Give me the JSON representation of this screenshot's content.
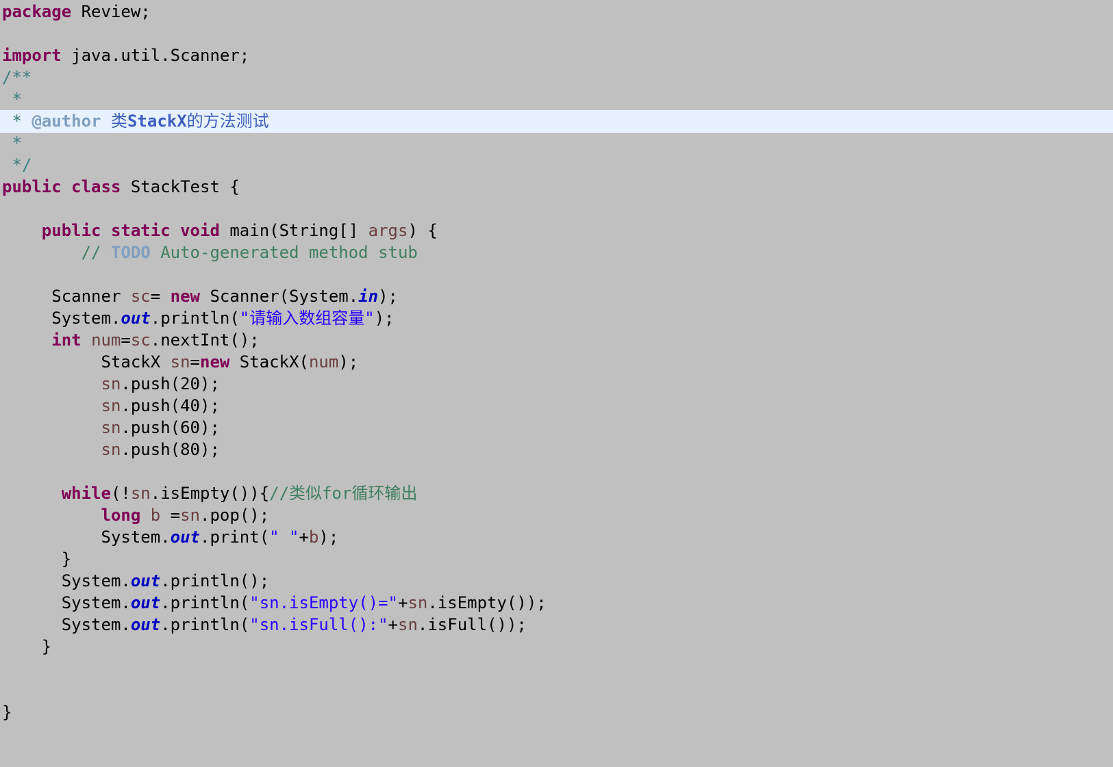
{
  "editor": {
    "background": "#c0c0c0",
    "current_line_highlight": "#e8f2fe",
    "colors": {
      "keyword": "#7f0055",
      "comment": "#3f7f5f",
      "javadoc": "#3f5fbf",
      "javadoc_tag": "#7f9fbf",
      "string": "#2a00ff",
      "static_field": "#0000c0",
      "local_variable": "#6a3e3e"
    },
    "lines": [
      {
        "tokens": [
          {
            "c": "kw",
            "t": "package"
          },
          {
            "c": "pl",
            "t": " Review;"
          }
        ]
      },
      {
        "tokens": []
      },
      {
        "tokens": [
          {
            "c": "kw",
            "t": "import"
          },
          {
            "c": "pl",
            "t": " java.util.Scanner;"
          }
        ]
      },
      {
        "tokens": [
          {
            "c": "dc-star",
            "t": "/**"
          }
        ]
      },
      {
        "tokens": [
          {
            "c": "dc-star",
            "t": " *"
          }
        ]
      },
      {
        "current": true,
        "tokens": [
          {
            "c": "dc-star",
            "t": " * "
          },
          {
            "c": "dc-tag",
            "t": "@author"
          },
          {
            "c": "dc-text",
            "t": " 类"
          },
          {
            "c": "dc-text-b",
            "t": "StackX"
          },
          {
            "c": "dc-text",
            "t": "的方法测试"
          }
        ]
      },
      {
        "tokens": [
          {
            "c": "dc-star",
            "t": " *"
          }
        ]
      },
      {
        "tokens": [
          {
            "c": "dc-star",
            "t": " */"
          }
        ]
      },
      {
        "tokens": [
          {
            "c": "kw",
            "t": "public"
          },
          {
            "c": "pl",
            "t": " "
          },
          {
            "c": "kw",
            "t": "class"
          },
          {
            "c": "pl",
            "t": " StackTest {"
          }
        ]
      },
      {
        "tokens": []
      },
      {
        "tokens": [
          {
            "c": "pl",
            "t": "    "
          },
          {
            "c": "kw",
            "t": "public"
          },
          {
            "c": "pl",
            "t": " "
          },
          {
            "c": "kw",
            "t": "static"
          },
          {
            "c": "pl",
            "t": " "
          },
          {
            "c": "kw",
            "t": "void"
          },
          {
            "c": "pl",
            "t": " main(String[] "
          },
          {
            "c": "var",
            "t": "args"
          },
          {
            "c": "pl",
            "t": ") {"
          }
        ]
      },
      {
        "tokens": [
          {
            "c": "pl",
            "t": "        "
          },
          {
            "c": "cm",
            "t": "// "
          },
          {
            "c": "todo",
            "t": "TODO"
          },
          {
            "c": "cm",
            "t": " Auto-generated method stub"
          }
        ]
      },
      {
        "tokens": []
      },
      {
        "tokens": [
          {
            "c": "pl",
            "t": "     Scanner "
          },
          {
            "c": "var",
            "t": "sc"
          },
          {
            "c": "pl",
            "t": "= "
          },
          {
            "c": "kw",
            "t": "new"
          },
          {
            "c": "pl",
            "t": " Scanner(System."
          },
          {
            "c": "sf",
            "t": "in"
          },
          {
            "c": "pl",
            "t": ");"
          }
        ]
      },
      {
        "tokens": [
          {
            "c": "pl",
            "t": "     System."
          },
          {
            "c": "sf",
            "t": "out"
          },
          {
            "c": "pl",
            "t": ".println("
          },
          {
            "c": "st",
            "t": "\"请输入数组容量\""
          },
          {
            "c": "pl",
            "t": ");"
          }
        ]
      },
      {
        "tokens": [
          {
            "c": "pl",
            "t": "     "
          },
          {
            "c": "kw",
            "t": "int"
          },
          {
            "c": "pl",
            "t": " "
          },
          {
            "c": "var",
            "t": "num"
          },
          {
            "c": "pl",
            "t": "="
          },
          {
            "c": "var",
            "t": "sc"
          },
          {
            "c": "pl",
            "t": ".nextInt();"
          }
        ]
      },
      {
        "tokens": [
          {
            "c": "pl",
            "t": "          StackX "
          },
          {
            "c": "var",
            "t": "sn"
          },
          {
            "c": "pl",
            "t": "="
          },
          {
            "c": "kw",
            "t": "new"
          },
          {
            "c": "pl",
            "t": " StackX("
          },
          {
            "c": "var",
            "t": "num"
          },
          {
            "c": "pl",
            "t": ");"
          }
        ]
      },
      {
        "tokens": [
          {
            "c": "pl",
            "t": "          "
          },
          {
            "c": "var",
            "t": "sn"
          },
          {
            "c": "pl",
            "t": ".push(20);"
          }
        ]
      },
      {
        "tokens": [
          {
            "c": "pl",
            "t": "          "
          },
          {
            "c": "var",
            "t": "sn"
          },
          {
            "c": "pl",
            "t": ".push(40);"
          }
        ]
      },
      {
        "tokens": [
          {
            "c": "pl",
            "t": "          "
          },
          {
            "c": "var",
            "t": "sn"
          },
          {
            "c": "pl",
            "t": ".push(60);"
          }
        ]
      },
      {
        "tokens": [
          {
            "c": "pl",
            "t": "          "
          },
          {
            "c": "var",
            "t": "sn"
          },
          {
            "c": "pl",
            "t": ".push(80);"
          }
        ]
      },
      {
        "tokens": []
      },
      {
        "tokens": [
          {
            "c": "pl",
            "t": "      "
          },
          {
            "c": "kw",
            "t": "while"
          },
          {
            "c": "pl",
            "t": "(!"
          },
          {
            "c": "var",
            "t": "sn"
          },
          {
            "c": "pl",
            "t": ".isEmpty()){"
          },
          {
            "c": "cm",
            "t": "//类似for循环输出"
          }
        ]
      },
      {
        "tokens": [
          {
            "c": "pl",
            "t": "          "
          },
          {
            "c": "kw",
            "t": "long"
          },
          {
            "c": "pl",
            "t": " "
          },
          {
            "c": "var",
            "t": "b"
          },
          {
            "c": "pl",
            "t": " ="
          },
          {
            "c": "var",
            "t": "sn"
          },
          {
            "c": "pl",
            "t": ".pop();"
          }
        ]
      },
      {
        "tokens": [
          {
            "c": "pl",
            "t": "          System."
          },
          {
            "c": "sf",
            "t": "out"
          },
          {
            "c": "pl",
            "t": ".print("
          },
          {
            "c": "st",
            "t": "\" \""
          },
          {
            "c": "pl",
            "t": "+"
          },
          {
            "c": "var",
            "t": "b"
          },
          {
            "c": "pl",
            "t": ");"
          }
        ]
      },
      {
        "tokens": [
          {
            "c": "pl",
            "t": "      }"
          }
        ]
      },
      {
        "tokens": [
          {
            "c": "pl",
            "t": "      System."
          },
          {
            "c": "sf",
            "t": "out"
          },
          {
            "c": "pl",
            "t": ".println();"
          }
        ]
      },
      {
        "tokens": [
          {
            "c": "pl",
            "t": "      System."
          },
          {
            "c": "sf",
            "t": "out"
          },
          {
            "c": "pl",
            "t": ".println("
          },
          {
            "c": "st",
            "t": "\"sn.isEmpty()=\""
          },
          {
            "c": "pl",
            "t": "+"
          },
          {
            "c": "var",
            "t": "sn"
          },
          {
            "c": "pl",
            "t": ".isEmpty());"
          }
        ]
      },
      {
        "tokens": [
          {
            "c": "pl",
            "t": "      System."
          },
          {
            "c": "sf",
            "t": "out"
          },
          {
            "c": "pl",
            "t": ".println("
          },
          {
            "c": "st",
            "t": "\"sn.isFull():\""
          },
          {
            "c": "pl",
            "t": "+"
          },
          {
            "c": "var",
            "t": "sn"
          },
          {
            "c": "pl",
            "t": ".isFull());"
          }
        ]
      },
      {
        "tokens": [
          {
            "c": "pl",
            "t": "    }"
          }
        ]
      },
      {
        "tokens": []
      },
      {
        "tokens": []
      },
      {
        "tokens": [
          {
            "c": "pl",
            "t": "}"
          }
        ]
      }
    ]
  }
}
